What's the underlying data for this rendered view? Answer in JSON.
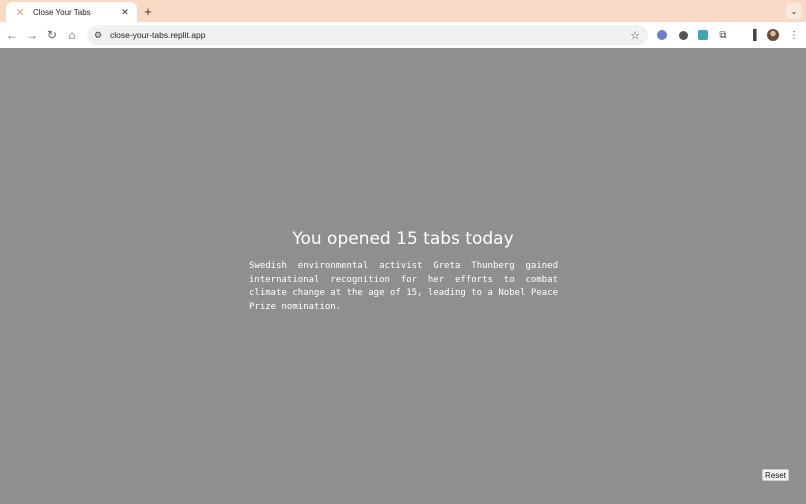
{
  "browser": {
    "tab": {
      "title": "Close Your Tabs",
      "favicon": "replit-icon"
    },
    "new_tab_label": "+",
    "url": "close-your-tabs.replit.app"
  },
  "page": {
    "headline": "You opened 15 tabs today",
    "fact": "Swedish environmental activist Greta Thunberg gained international recognition for her efforts to combat climate change at the age of 15, leading to a Nobel Peace Prize nomination.",
    "reset_label": "Reset",
    "background_color": "#8f8f8f"
  }
}
